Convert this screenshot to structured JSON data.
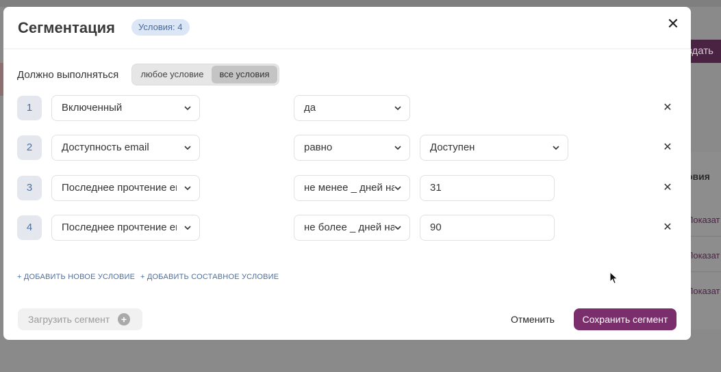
{
  "background": {
    "create_button": "здать",
    "column_header": "овия",
    "row_links": [
      "Показат",
      "Показат",
      "Показат"
    ]
  },
  "modal": {
    "title": "Сегментация",
    "badge": "Условия: 4",
    "close_icon": "close-icon",
    "must_label": "Должно выполняться",
    "toggle": {
      "options": [
        "любое условие",
        "все условия"
      ],
      "selected": "все условия"
    },
    "conditions": [
      {
        "num": "1",
        "attribute": "Включенный",
        "operator": "да",
        "value": "",
        "value_type": "none"
      },
      {
        "num": "2",
        "attribute": "Доступность email",
        "operator": "равно",
        "value": "Доступен",
        "value_type": "select"
      },
      {
        "num": "3",
        "attribute": "Последнее прочтение email",
        "operator": "не менее _ дней назад",
        "value": "31",
        "value_type": "input"
      },
      {
        "num": "4",
        "attribute": "Последнее прочтение email",
        "operator": "не более _ дней назад",
        "value": "90",
        "value_type": "input"
      }
    ],
    "add_condition": "+ ДОБАВИТЬ НОВОЕ УСЛОВИЕ",
    "add_compound": "+ ДОБАВИТЬ СОСТАВНОЕ УСЛОВИЕ",
    "load_segment": "Загрузить сегмент",
    "cancel": "Отменить",
    "save": "Сохранить сегмент"
  },
  "colors": {
    "accent": "#7a2f6c",
    "badge_bg": "#dbe6f6",
    "link": "#4b6ea0"
  }
}
